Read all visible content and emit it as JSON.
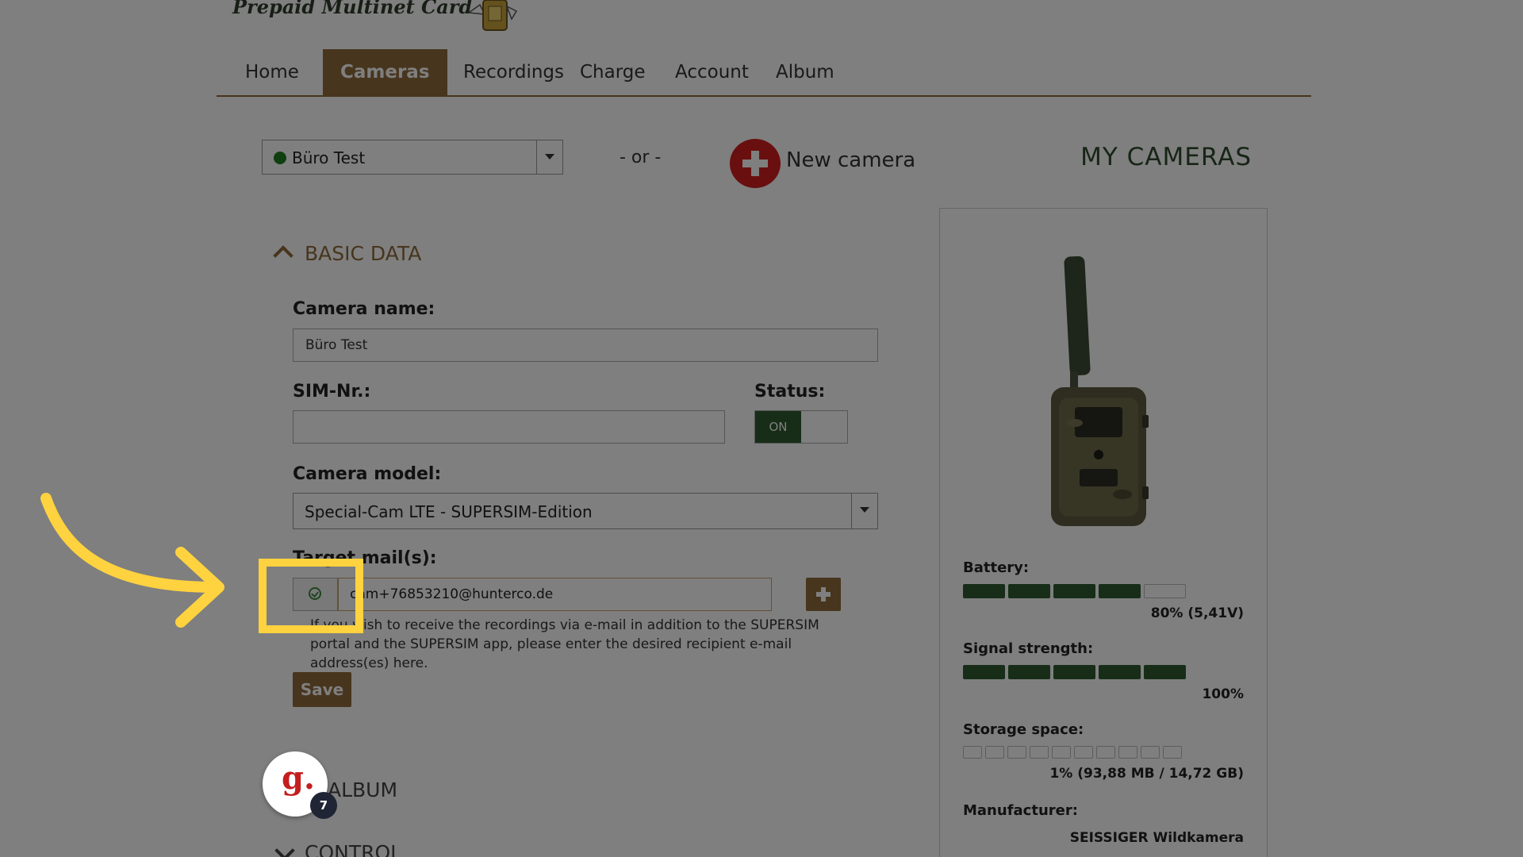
{
  "header": {
    "logo_text": "Prepaid Multinet Card"
  },
  "nav": {
    "items": [
      {
        "label": "Home",
        "active": false
      },
      {
        "label": "Cameras",
        "active": true
      },
      {
        "label": "Recordings",
        "active": false
      },
      {
        "label": "Charge",
        "active": false
      },
      {
        "label": "Account",
        "active": false
      },
      {
        "label": "Album",
        "active": false
      }
    ]
  },
  "toolbar": {
    "camera_select_value": "Büro Test",
    "or_text": "- or -",
    "new_camera_label": "New camera",
    "my_cameras_title": "MY CAMERAS"
  },
  "basic_data": {
    "title": "BASIC DATA",
    "camera_name_label": "Camera name:",
    "camera_name_value": "Büro Test",
    "sim_label": "SIM-Nr.:",
    "sim_value": "",
    "status_label": "Status:",
    "status_value": "ON",
    "model_label": "Camera model:",
    "model_value": "Special-Cam LTE - SUPERSIM-Edition",
    "target_mail_label": "Target mail(s):",
    "target_mail_value": "cam+76853210@hunterco.de",
    "help_text": "If you wish to receive the recordings via e-mail in addition to the SUPERSIM portal and the SUPERSIM app, please enter the desired recipient e-mail address(es) here.",
    "save_label": "Save"
  },
  "sections": {
    "album_title": "ALBUM",
    "control_title": "CONTROL"
  },
  "notification_badge": {
    "letter": "g.",
    "count": "7"
  },
  "camera_panel": {
    "battery_label": "Battery:",
    "battery_level": 0.8,
    "battery_value": "80% (5,41V)",
    "signal_label": "Signal strength:",
    "signal_level": 1.0,
    "signal_value": "100%",
    "storage_label": "Storage space:",
    "storage_level": 0.01,
    "storage_value": "1% (93,88 MB / 14,72 GB)",
    "manufacturer_label": "Manufacturer:",
    "manufacturer_value": "SEISSIGER Wildkamera"
  },
  "colors": {
    "accent": "#8e6a3a",
    "status_green": "#2f5a31",
    "highlight": "#ffd23f"
  }
}
